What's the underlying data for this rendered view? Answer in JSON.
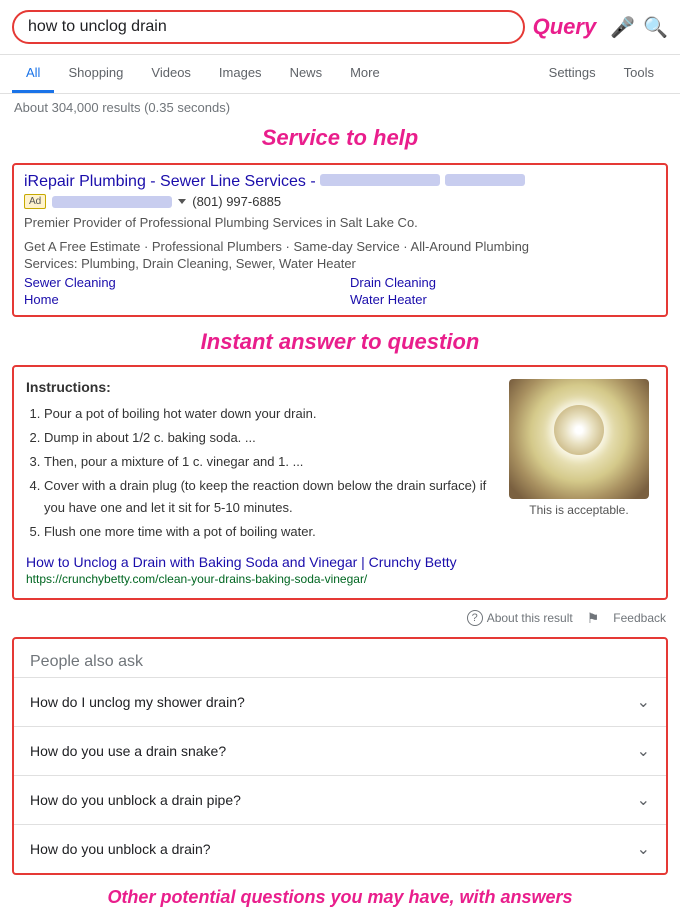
{
  "search": {
    "query": "how to unclog drain",
    "query_label": "Query",
    "mic_icon": "🎤",
    "search_icon": "🔍"
  },
  "nav": {
    "tabs": [
      {
        "label": "All",
        "active": true
      },
      {
        "label": "Shopping",
        "active": false
      },
      {
        "label": "Videos",
        "active": false
      },
      {
        "label": "Images",
        "active": false
      },
      {
        "label": "News",
        "active": false
      },
      {
        "label": "More",
        "active": false
      }
    ],
    "settings_label": "Settings",
    "tools_label": "Tools"
  },
  "results_count": "About 304,000 results (0.35 seconds)",
  "service_label": "Service to help",
  "ad": {
    "title": "iRepair Plumbing - Sewer Line Services -",
    "badge_label": "Ad",
    "phone": "(801) 997-6885",
    "description": "Premier Provider of Professional Plumbing Services in Salt Lake Co.",
    "highlights": "Get A Free Estimate · Professional Plumbers · Same-day Service · All-Around Plumbing",
    "services_line": "Services: Plumbing, Drain Cleaning, Sewer, Water Heater",
    "links": [
      {
        "label": "Sewer Cleaning",
        "col": 1
      },
      {
        "label": "Drain Cleaning",
        "col": 2
      },
      {
        "label": "Home",
        "col": 1
      },
      {
        "label": "Water Heater",
        "col": 2
      }
    ]
  },
  "instant_label": "Instant answer to question",
  "answer": {
    "instructions_title": "Instructions:",
    "steps": [
      "Pour a pot of boiling hot water down your drain.",
      "Dump in about 1/2 c. baking soda. ...",
      "Then, pour a mixture of 1 c. vinegar and 1. ...",
      "Cover with a drain plug (to keep the reaction down below the drain surface) if you have one and let it sit for 5-10 minutes.",
      "Flush one more time with a pot of boiling water."
    ],
    "source_title": "How to Unclog a Drain with Baking Soda and Vinegar | Crunchy Betty",
    "source_url": "https://crunchybetty.com/clean-your-drains-baking-soda-vinegar/",
    "image_caption": "This is acceptable."
  },
  "about_row": {
    "about_label": "About this result",
    "feedback_label": "Feedback"
  },
  "paa": {
    "title": "People also ask",
    "questions": [
      "How do I unclog my shower drain?",
      "How do you use a drain snake?",
      "How do you unblock a drain pipe?",
      "How do you unblock a drain?"
    ]
  },
  "bottom_label": "Other potential questions you may have, with answers"
}
